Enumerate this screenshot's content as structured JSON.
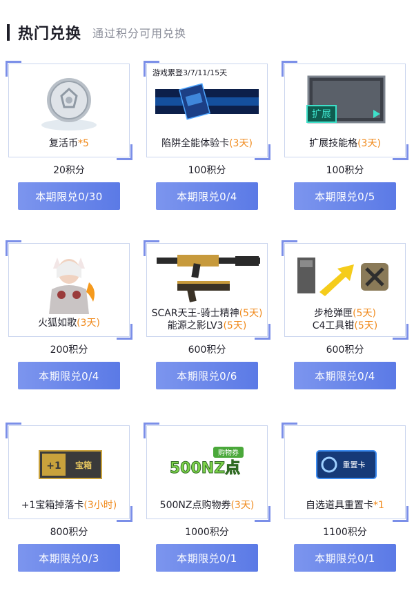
{
  "header": {
    "title": "热门兑换",
    "subtitle": "通过积分可用兑换"
  },
  "items": [
    {
      "name": "复活币",
      "highlight": "*5",
      "points": "20积分",
      "button": "本期限兑0/30",
      "icon": "silver-coin-icon"
    },
    {
      "tag": "游戏累登3/7/11/15天",
      "name": "陷阱全能体验卡",
      "highlight": "(3天)",
      "points": "100积分",
      "button": "本期限兑0/4",
      "icon": "trap-card-icon"
    },
    {
      "name": "扩展技能格",
      "highlight": "(3天)",
      "points": "100积分",
      "button": "本期限兑0/5",
      "icon": "skill-slot-icon",
      "art_text": "扩展"
    },
    {
      "name": "火狐如歌",
      "highlight": "(3天)",
      "points": "200积分",
      "button": "本期限兑0/4",
      "icon": "character-icon"
    },
    {
      "name": "SCAR天王-骑士精神",
      "highlight": "(5天)",
      "name2": "能源之影LV3",
      "highlight2": "(5天)",
      "points": "600积分",
      "button": "本期限兑0/6",
      "icon": "weapon-icon"
    },
    {
      "name": "步枪弹匣",
      "highlight": "(5天)",
      "name2": "C4工具钳",
      "highlight2": "(5天)",
      "points": "600积分",
      "button": "本期限兑0/4",
      "icon": "magazine-pliers-icon"
    },
    {
      "name": "+1宝箱掉落卡",
      "highlight": "(3小时)",
      "points": "800积分",
      "button": "本期限兑0/3",
      "icon": "chest-drop-card-icon",
      "art_text": "+1 宝箱"
    },
    {
      "name": "500NZ点购物券",
      "highlight": "(3天)",
      "points": "1000积分",
      "button": "本期限兑0/1",
      "icon": "voucher-icon",
      "art_text": "500NZ点",
      "art_text2": "购物券"
    },
    {
      "name": "自选道具重置卡",
      "highlight": "*1",
      "points": "1100积分",
      "button": "本期限兑0/1",
      "icon": "reset-card-icon",
      "art_text": "重置卡"
    }
  ]
}
